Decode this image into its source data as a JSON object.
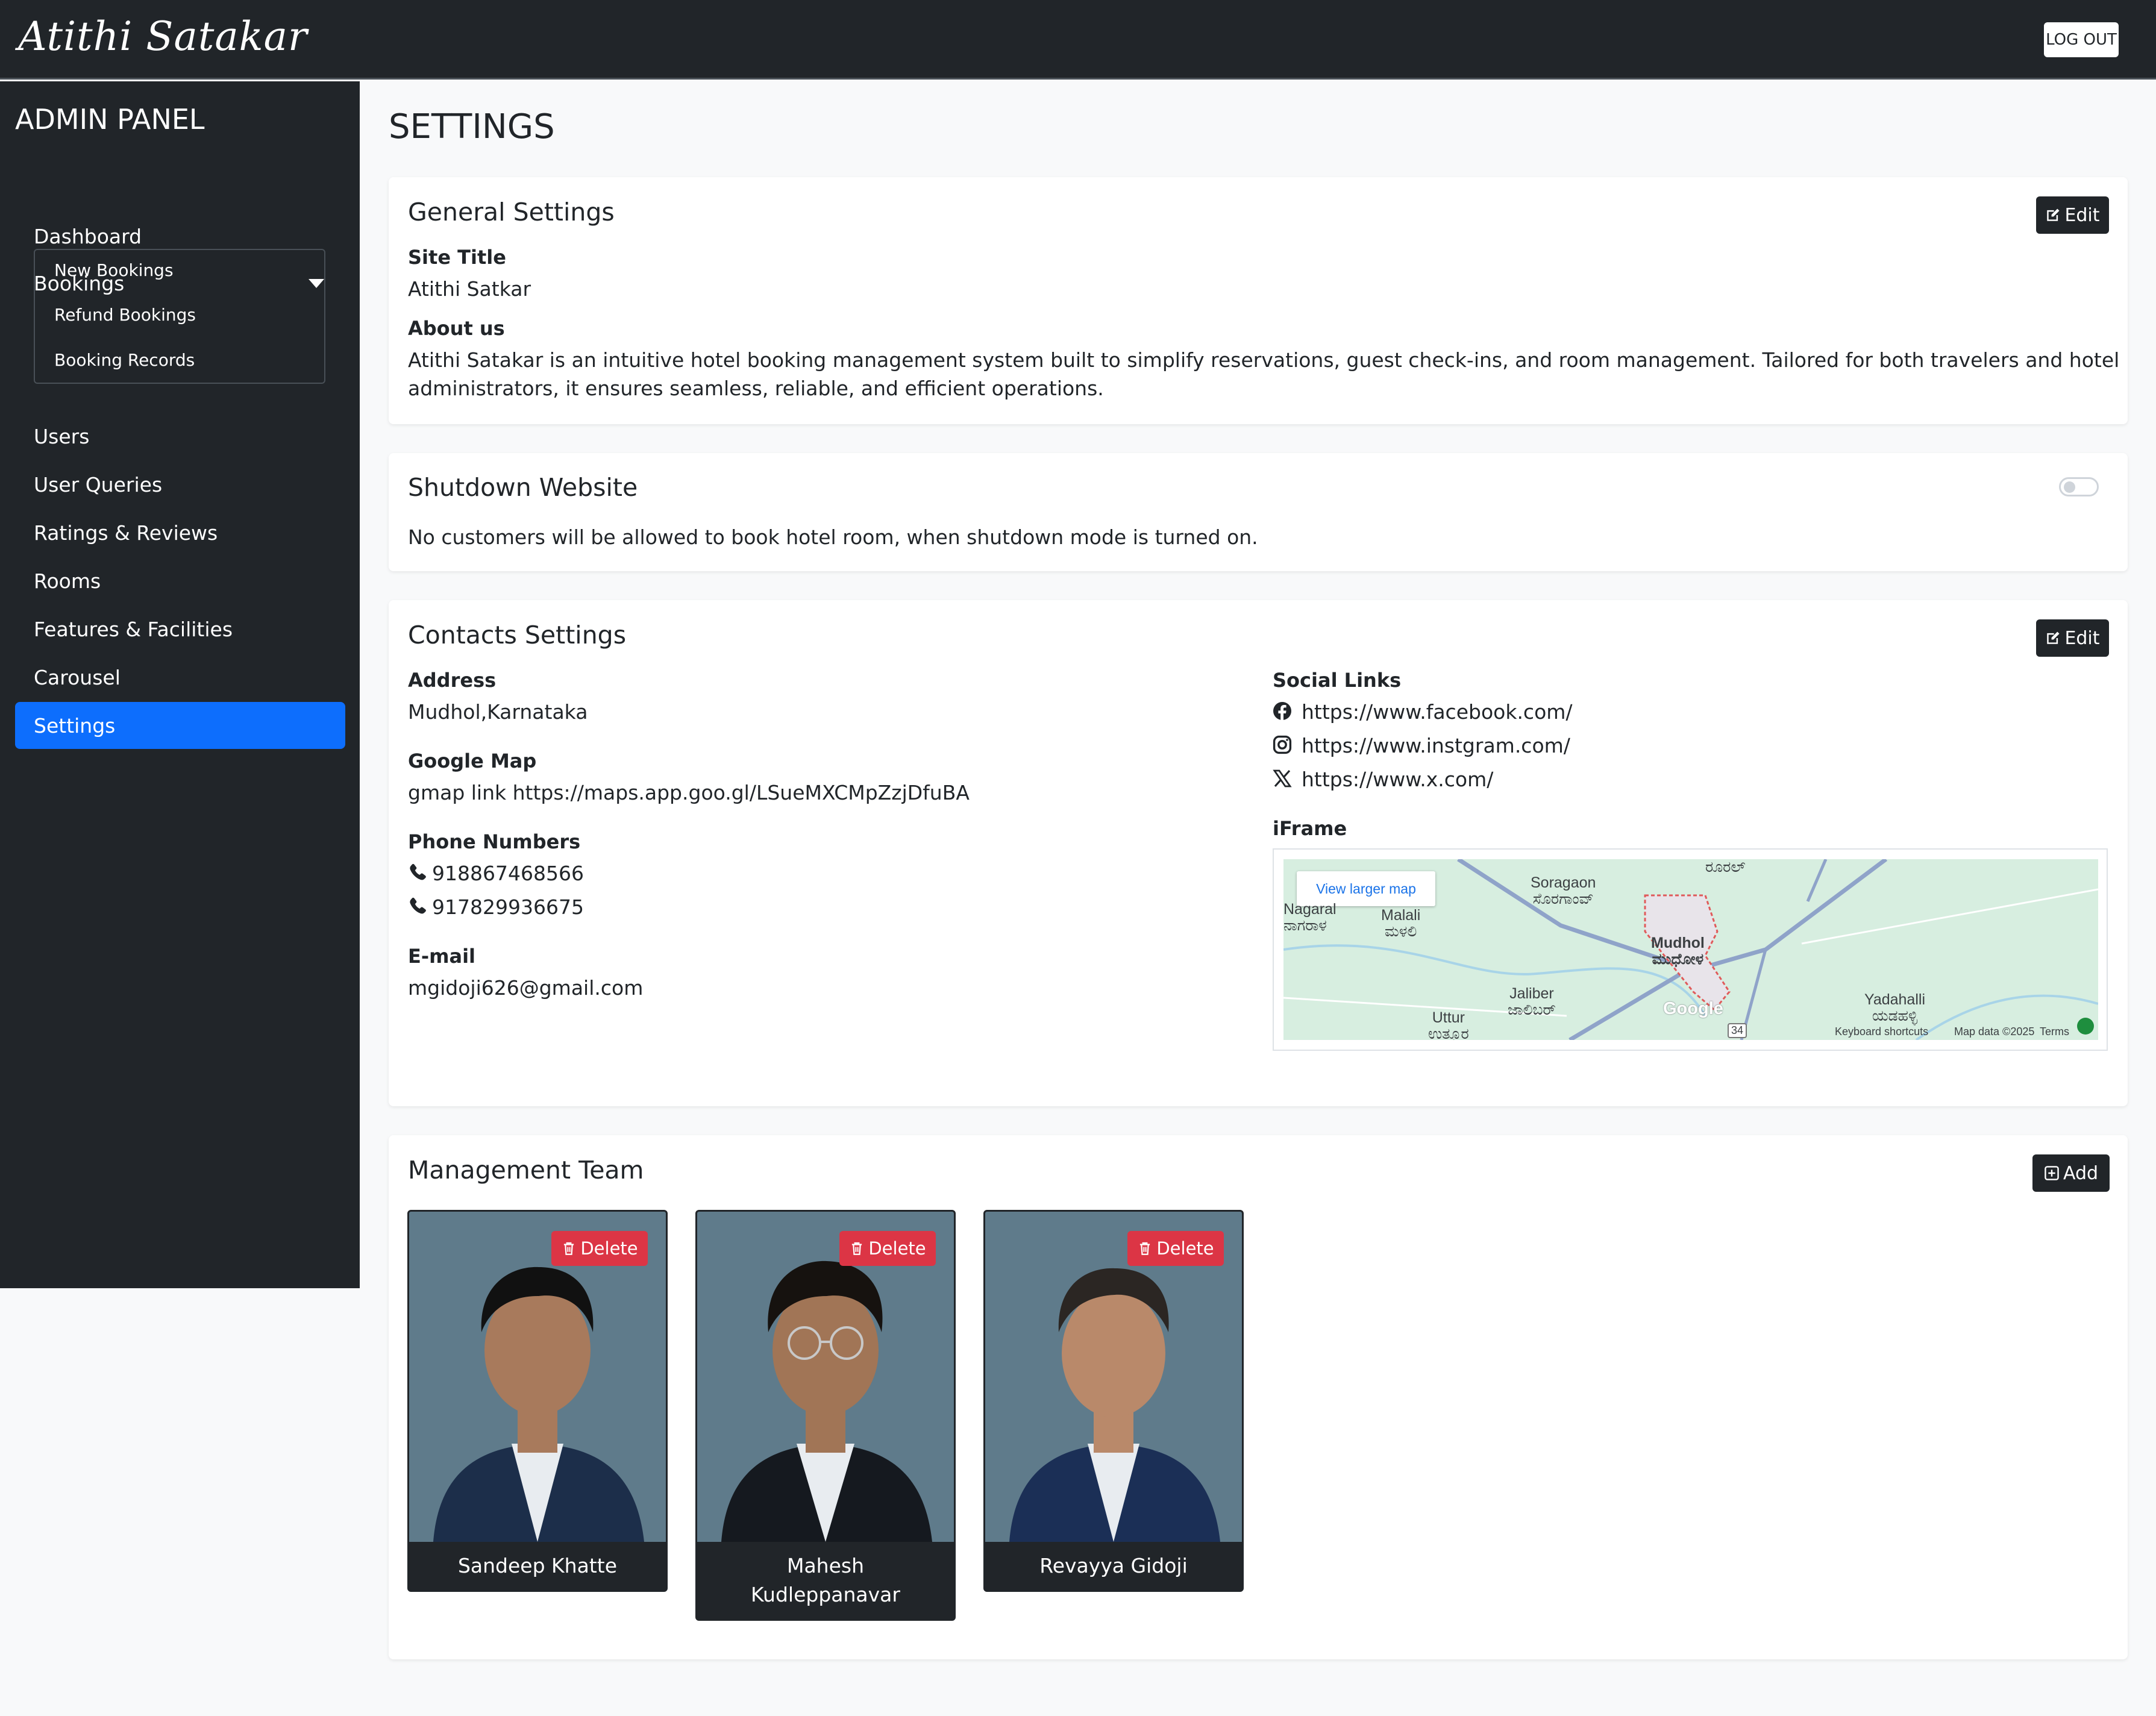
{
  "app": {
    "brand": "Atithi Satakar",
    "logout_label": "LOG OUT"
  },
  "sidebar": {
    "title": "ADMIN PANEL",
    "items": [
      {
        "label": "Dashboard"
      },
      {
        "label": "Bookings"
      },
      {
        "label": "Users"
      },
      {
        "label": "User Queries"
      },
      {
        "label": "Ratings & Reviews"
      },
      {
        "label": "Rooms"
      },
      {
        "label": "Features & Facilities"
      },
      {
        "label": "Carousel"
      },
      {
        "label": "Settings"
      }
    ],
    "bookings_submenu": [
      {
        "label": "New Bookings"
      },
      {
        "label": "Refund Bookings"
      },
      {
        "label": "Booking Records"
      }
    ],
    "active_item": "Settings"
  },
  "page": {
    "title": "SETTINGS"
  },
  "general": {
    "title": "General Settings",
    "edit_label": "Edit",
    "site_title_label": "Site Title",
    "site_title_value": "Atithi Satkar",
    "about_label": "About us",
    "about_line1": "Atithi Satakar is an intuitive hotel booking management system built to simplify reservations, guest check-ins, and room management. Tailored for both travelers and hotel",
    "about_line2": "administrators, it ensures seamless, reliable, and efficient operations."
  },
  "shutdown": {
    "title": "Shutdown Website",
    "enabled": false,
    "description": "No customers will be allowed to book hotel room, when shutdown mode is turned on."
  },
  "contacts": {
    "title": "Contacts Settings",
    "edit_label": "Edit",
    "address_label": "Address",
    "address_value": "Mudhol,Karnataka",
    "gmap_label": "Google Map",
    "gmap_value": "gmap link https://maps.app.goo.gl/LSueMXCMpZzjDfuBA",
    "phones_label": "Phone Numbers",
    "phones": [
      "918867468566",
      "917829936675"
    ],
    "email_label": "E-mail",
    "email_value": "mgidoji626@gmail.com",
    "social_label": "Social Links",
    "social": [
      {
        "icon": "facebook-icon",
        "url": "https://www.facebook.com/"
      },
      {
        "icon": "instagram-icon",
        "url": "https://www.instgram.com/"
      },
      {
        "icon": "x-icon",
        "url": "https://www.x.com/"
      }
    ],
    "iframe_label": "iFrame",
    "map": {
      "larger_map_label": "View larger map",
      "places": {
        "nagaral": "Nagaral",
        "nagaral_kn": "ನಾಗರಾಳ",
        "malali": "Malali",
        "malali_kn": "ಮಳಲಿ",
        "soragaon": "Soragaon",
        "soragaon_kn": "ಸೊರಗಾಂವ್",
        "top_kn": "ರೂರಲ್",
        "mudhol": "Mudhol",
        "mudhol_kn": "ಮುಧೋಳ",
        "jaliber": "Jaliber",
        "jaliber_kn": "ಜಾಲಿಬರ್",
        "uttur": "Uttur",
        "uttur_kn": "ಉತ್ತೂರ",
        "yadahalli": "Yadahalli",
        "yadahalli_kn": "ಯಡಹಳ್ಳಿ"
      },
      "google": "Google",
      "road_shield": "34",
      "keyboard": "Keyboard shortcuts",
      "map_data": "Map data ©2025",
      "terms": "Terms"
    }
  },
  "team": {
    "title": "Management Team",
    "add_label": "Add",
    "delete_label": "Delete",
    "members": [
      {
        "name": "Sandeep Khatte",
        "suit": "#1c2e4a",
        "hair": "#111111",
        "skin": "#a87a5c"
      },
      {
        "name_line1": "Mahesh",
        "name_line2": "Kudleppanavar",
        "suit": "#15191f",
        "hair": "#16120f",
        "skin": "#a17556"
      },
      {
        "name": "Revayya Gidoji",
        "suit": "#1b2f56",
        "hair": "#2b2623",
        "skin": "#b9896a"
      }
    ]
  },
  "colors": {
    "primary": "#0d6efd",
    "danger": "#dc3545",
    "dark": "#212529",
    "page_bg": "#f8f9fa"
  }
}
